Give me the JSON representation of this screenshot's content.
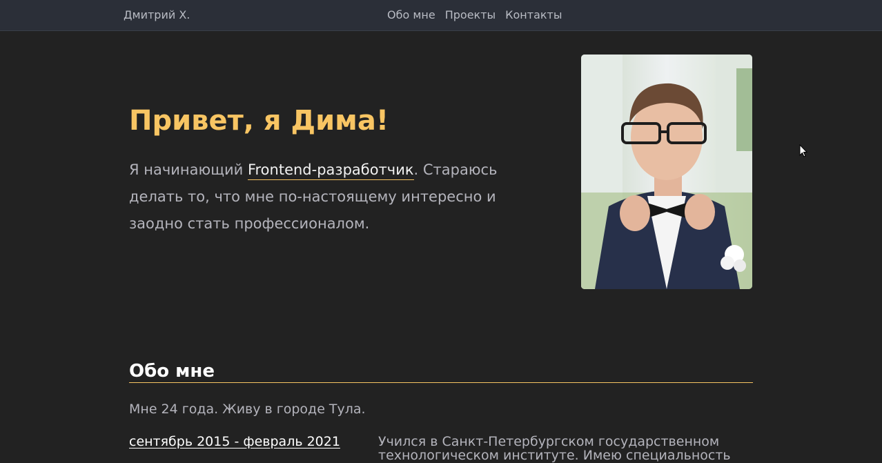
{
  "nav": {
    "brand": "Дмитрий Х.",
    "links": [
      "Обо мне",
      "Проекты",
      "Контакты"
    ]
  },
  "hero": {
    "title": "Привет, я Дима!",
    "text_before": "Я начинающий ",
    "text_highlight": "Frontend-разработчик",
    "text_after": ". Стараюсь делать то, что мне по-настоящему интересно и заодно стать профессионалом."
  },
  "about": {
    "title": "Обо мне",
    "text": "Мне 24 года. Живу в городе Тула.",
    "education": {
      "period": "сентябрь 2015 - февраль 2021",
      "description": "Учился в Санкт-Петербургском государственном технологическом институте. Имею специальность"
    }
  },
  "colors": {
    "background": "#222222",
    "navbar": "#2b2f38",
    "accent": "#f8c563",
    "text": "#b4b4bc"
  }
}
